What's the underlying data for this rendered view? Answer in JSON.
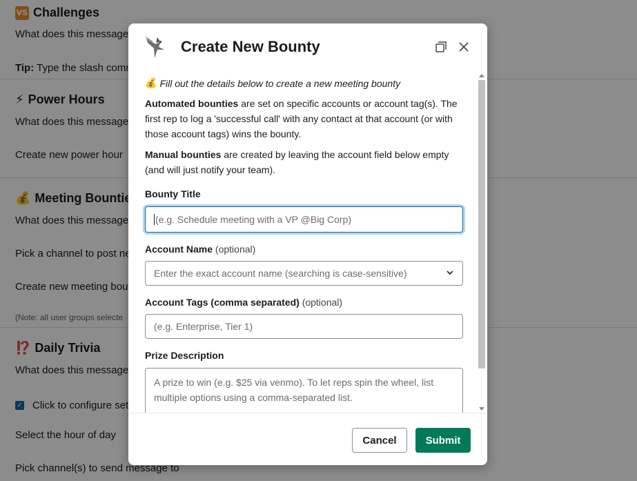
{
  "background": {
    "sections": [
      {
        "title": "Challenges",
        "badge": "VS",
        "lines": [
          "What does this message",
          "Tip:",
          " Type the slash comm"
        ]
      },
      {
        "title": "Power Hours",
        "icon": "⚡",
        "lines": [
          "What does this message",
          "Create new power hour"
        ]
      },
      {
        "title": "Meeting Bounties",
        "icon": "💰",
        "lines": [
          "What does this message",
          "Pick a channel to post ne",
          "Create new meeting boun",
          "(Note: all user groups selecte"
        ]
      },
      {
        "title": "Daily Trivia",
        "icon": "⁉️",
        "lines": [
          "What does this message",
          "Click to configure set",
          "Select the hour of day",
          "Pick channel(s) to send message to"
        ]
      }
    ]
  },
  "modal": {
    "title": "Create New Bounty",
    "intro_icon": "💰",
    "intro": "Fill out the details below to create a new meeting bounty",
    "automated_bold": "Automated bounties",
    "automated_text": " are set on specific accounts or account tag(s). The first rep to log a 'successful call' with any contact at that account (or with those account tags) wins the bounty.",
    "manual_bold": "Manual bounties",
    "manual_text": " are created by leaving the account field below empty (and will just notify your team).",
    "fields": {
      "bounty_title": {
        "label": "Bounty Title",
        "placeholder": "(e.g. Schedule meeting with a VP @Big Corp)"
      },
      "account_name": {
        "label": "Account Name",
        "optional": "(optional)",
        "placeholder": "Enter the exact account name (searching is case-sensitive)"
      },
      "account_tags": {
        "label": "Account Tags (comma separated)",
        "optional": "(optional)",
        "placeholder": "(e.g. Enterprise, Tier 1)"
      },
      "prize": {
        "label": "Prize Description",
        "placeholder": "A prize to win (e.g. $25 via venmo). To let reps spin the wheel, list multiple options using a comma-separated list."
      }
    },
    "cancel_label": "Cancel",
    "submit_label": "Submit",
    "icons": {
      "popout": "popout-icon",
      "close": "close-icon",
      "chevron": "chevron-down-icon",
      "logo": "bird-logo-icon"
    },
    "colors": {
      "submit": "#007a5a",
      "focus": "#1264a3"
    }
  }
}
